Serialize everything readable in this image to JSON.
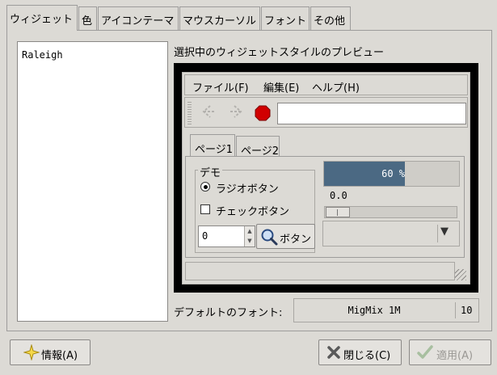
{
  "tabs": [
    {
      "label": "ウィジェット",
      "active": true
    },
    {
      "label": "色"
    },
    {
      "label": "アイコンテーマ"
    },
    {
      "label": "マウスカーソル"
    },
    {
      "label": "フォント"
    },
    {
      "label": "その他"
    }
  ],
  "theme_list": {
    "items": [
      "Raleigh"
    ]
  },
  "preview": {
    "title": "選択中のウィジェットスタイルのプレビュー",
    "menu": {
      "file": "ファイル(F)",
      "edit": "編集(E)",
      "help": "ヘルプ(H)"
    },
    "toolbar": {
      "icons": [
        "back-arrow-icon",
        "forward-arrow-icon",
        "stop-icon"
      ],
      "entry_value": ""
    },
    "notebook_tabs": [
      "ページ1",
      "ページ2"
    ],
    "demo": {
      "frame_label": "デモ",
      "radio_label": "ラジオボタン",
      "radio_checked": true,
      "check_label": "チェックボタン",
      "check_checked": false,
      "spin_value": "0",
      "search_button_label": "ボタン"
    },
    "progress": {
      "fraction": 0.6,
      "text": "60 %",
      "color": "#4b6983"
    },
    "scale_value": "0.0"
  },
  "font": {
    "label": "デフォルトのフォント:",
    "name": "MigMix 1M",
    "size": "10"
  },
  "buttons": {
    "about": "情報(A)",
    "close": "閉じる(C)",
    "apply": "適用(A)"
  }
}
